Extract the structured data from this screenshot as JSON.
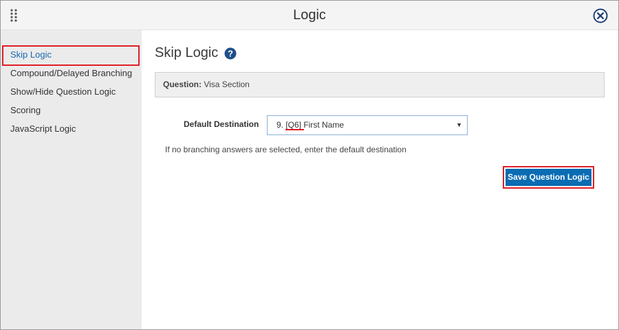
{
  "window": {
    "title": "Logic",
    "drag_icon": "grip-dots-icon",
    "close_icon": "close-circle-icon"
  },
  "sidebar": {
    "items": [
      {
        "label": "Skip Logic",
        "active": true
      },
      {
        "label": "Compound/Delayed Branching",
        "active": false
      },
      {
        "label": "Show/Hide Question Logic",
        "active": false
      },
      {
        "label": "Scoring",
        "active": false
      },
      {
        "label": "JavaScript Logic",
        "active": false
      }
    ]
  },
  "main": {
    "section_title": "Skip Logic",
    "help_icon": "question-circle-icon",
    "question": {
      "label": "Question:",
      "value": "Visa Section"
    },
    "default_destination": {
      "label": "Default Destination",
      "selected": "9. [Q6] First Name"
    },
    "hint": "If no branching answers are selected, enter the default destination",
    "save_label": "Save Question Logic"
  },
  "colors": {
    "accent": "#0a6cb3",
    "active_link": "#1a6ab0",
    "highlight": "#e11d27",
    "sidebar_bg": "#ebebeb"
  }
}
